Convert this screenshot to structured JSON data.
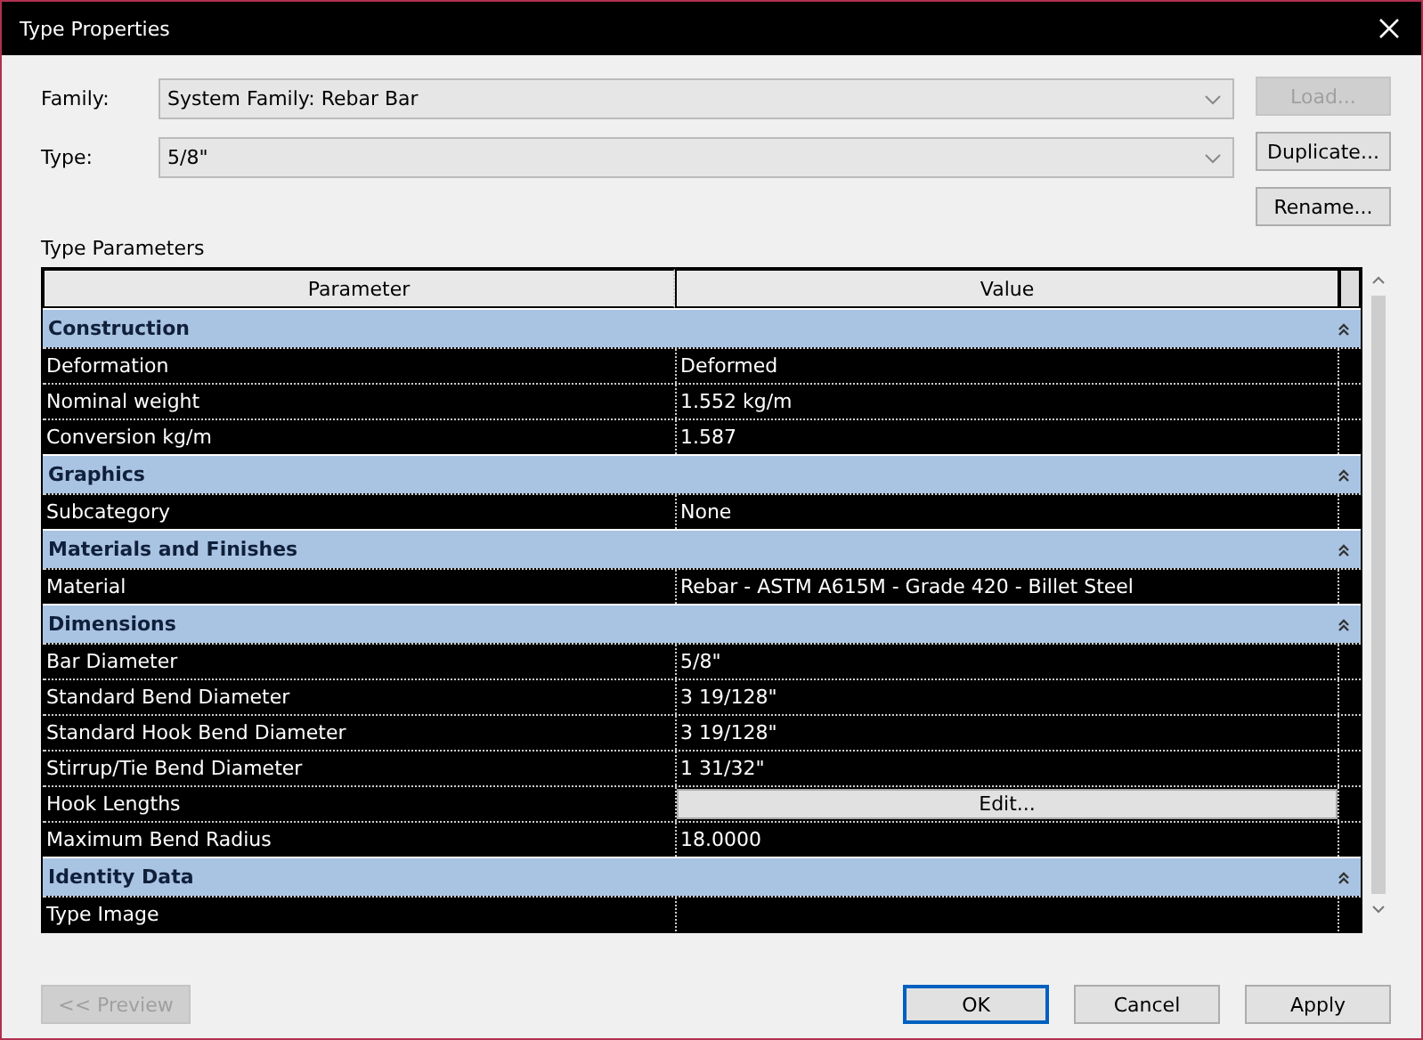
{
  "window": {
    "title": "Type Properties"
  },
  "family": {
    "label": "Family:",
    "value": "System Family: Rebar Bar"
  },
  "type": {
    "label": "Type:",
    "value": "5/8\""
  },
  "side_buttons": [
    {
      "label": "Load...",
      "disabled": true
    },
    {
      "label": "Duplicate...",
      "disabled": false
    },
    {
      "label": "Rename...",
      "disabled": false
    }
  ],
  "section_label": "Type Parameters",
  "table": {
    "columns": [
      "Parameter",
      "Value"
    ],
    "groups": [
      {
        "name": "Construction",
        "expanded": true,
        "rows": [
          {
            "kind": "param",
            "name": "Deformation",
            "value": "Deformed"
          },
          {
            "kind": "param",
            "name": "Nominal weight",
            "value": "1.552 kg/m"
          },
          {
            "kind": "param",
            "name": "Conversion kg/m",
            "value": "1.587"
          }
        ]
      },
      {
        "name": "Graphics",
        "expanded": true,
        "rows": [
          {
            "kind": "param",
            "name": "Subcategory",
            "value": "None"
          }
        ]
      },
      {
        "name": "Materials and Finishes",
        "expanded": true,
        "rows": [
          {
            "kind": "param",
            "name": "Material",
            "value": "Rebar - ASTM A615M - Grade 420 - Billet Steel"
          }
        ]
      },
      {
        "name": "Dimensions",
        "expanded": true,
        "rows": [
          {
            "kind": "param",
            "name": "Bar Diameter",
            "value": "5/8\""
          },
          {
            "kind": "param",
            "name": "Standard Bend Diameter",
            "value": "3 19/128\""
          },
          {
            "kind": "param",
            "name": "Standard Hook Bend Diameter",
            "value": "3 19/128\""
          },
          {
            "kind": "param",
            "name": "Stirrup/Tie Bend Diameter",
            "value": "1 31/32\""
          },
          {
            "kind": "button",
            "name": "Hook Lengths",
            "value": "Edit..."
          },
          {
            "kind": "param",
            "name": "Maximum Bend Radius",
            "value": "18.0000"
          }
        ]
      },
      {
        "name": "Identity Data",
        "expanded": true,
        "rows": [
          {
            "kind": "param",
            "name": "Type Image",
            "value": ""
          }
        ]
      }
    ]
  },
  "preview_button": {
    "label": "<< Preview",
    "disabled": true
  },
  "footer_buttons": [
    {
      "label": "OK",
      "selected": true
    },
    {
      "label": "Cancel",
      "selected": false
    },
    {
      "label": "Apply",
      "selected": false
    }
  ]
}
